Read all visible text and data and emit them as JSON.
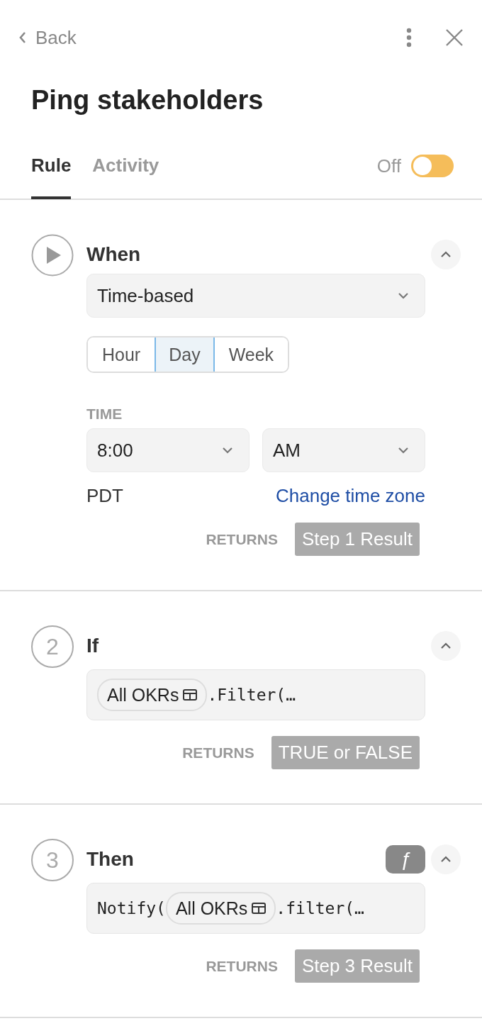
{
  "header": {
    "back": "Back",
    "title": "Ping stakeholders"
  },
  "tabs": [
    {
      "label": "Rule",
      "selected": true
    },
    {
      "label": "Activity",
      "selected": false
    }
  ],
  "toggle": {
    "label": "Off",
    "on": false
  },
  "steps": [
    {
      "kind": "trigger",
      "title": "When",
      "expanded": true,
      "trigger_type": "Time-based",
      "frequency": [
        {
          "label": "Hour",
          "selected": false
        },
        {
          "label": "Day",
          "selected": true
        },
        {
          "label": "Week",
          "selected": false
        }
      ],
      "time_label": "TIME",
      "time": "8:00",
      "period": "AM",
      "timezone": "PDT",
      "timezone_link": "Change time zone",
      "returns_label": "RETURNS",
      "returns": "Step 1 Result"
    },
    {
      "kind": "formula",
      "number": "2",
      "title": "If",
      "expanded": true,
      "formula": [
        {
          "kind": "chip",
          "text": "All OKRs"
        },
        {
          "kind": "code",
          "text": ".Filter(…"
        }
      ],
      "returns_label": "RETURNS",
      "returns": "TRUE or FALSE"
    },
    {
      "kind": "formula",
      "number": "3",
      "title": "Then",
      "expanded": true,
      "badge": "ƒ",
      "formula": [
        {
          "kind": "code",
          "text": "Notify("
        },
        {
          "kind": "chip",
          "text": "All OKRs"
        },
        {
          "kind": "code",
          "text": ".filter(…"
        }
      ],
      "returns_label": "RETURNS",
      "returns": "Step 3 Result"
    }
  ]
}
